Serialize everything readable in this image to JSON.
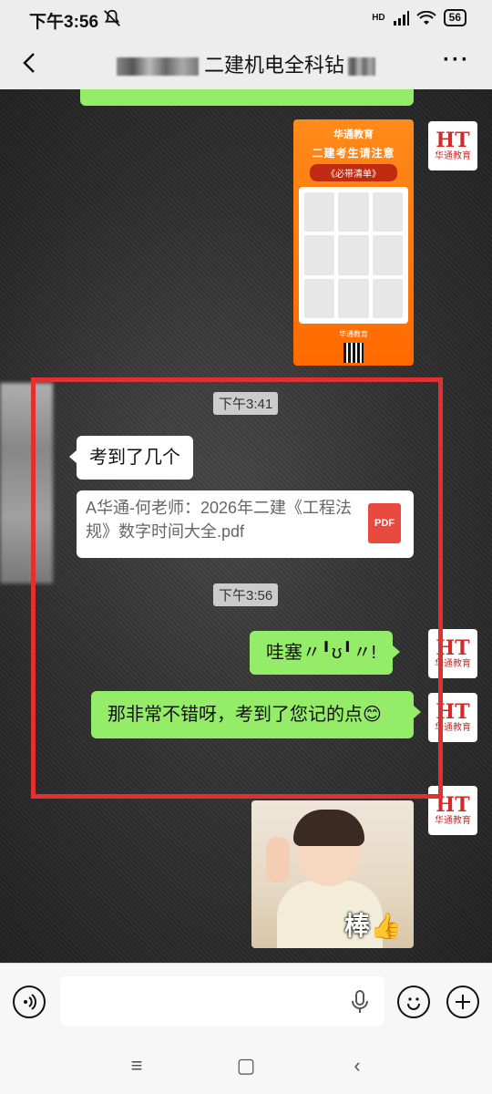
{
  "status_bar": {
    "time": "下午3:56",
    "network": "HD",
    "battery": "56",
    "icons": [
      "mute-icon",
      "signal-icon",
      "wifi-icon",
      "battery-icon"
    ]
  },
  "header": {
    "title": "二建机电全科钻",
    "icons": [
      "back-icon",
      "more-icon"
    ]
  },
  "poster": {
    "brand": "华通教育",
    "title": "二建考生请注意",
    "subtitle": "《必带清单》",
    "footer": "华通教育"
  },
  "avatar": {
    "logo": "HT",
    "caption": "华通教育"
  },
  "messages": {
    "time1": "下午3:41",
    "incoming_text": "考到了几个",
    "file_name": "A华通-何老师：2026年二建《工程法规》数字时间大全.pdf",
    "file_type": "PDF",
    "time2": "下午3:56",
    "outgoing1": "哇塞〃╹ʊ╹〃!",
    "outgoing2": "那非常不错呀，考到了您记的点😊",
    "sticker_caption": "棒",
    "sticker_emoji": "👍"
  },
  "input_bar": {
    "placeholder": "",
    "icons": [
      "voice-icon",
      "microphone-icon",
      "emoji-icon",
      "plus-icon"
    ]
  },
  "nav_bar": {
    "menu": "≡",
    "home": "▢",
    "back": "‹"
  },
  "colors": {
    "accent_green": "#95ec69",
    "highlight_red": "#e0302f",
    "brand_red": "#d42a2a",
    "poster_orange": "#ff7a10"
  }
}
